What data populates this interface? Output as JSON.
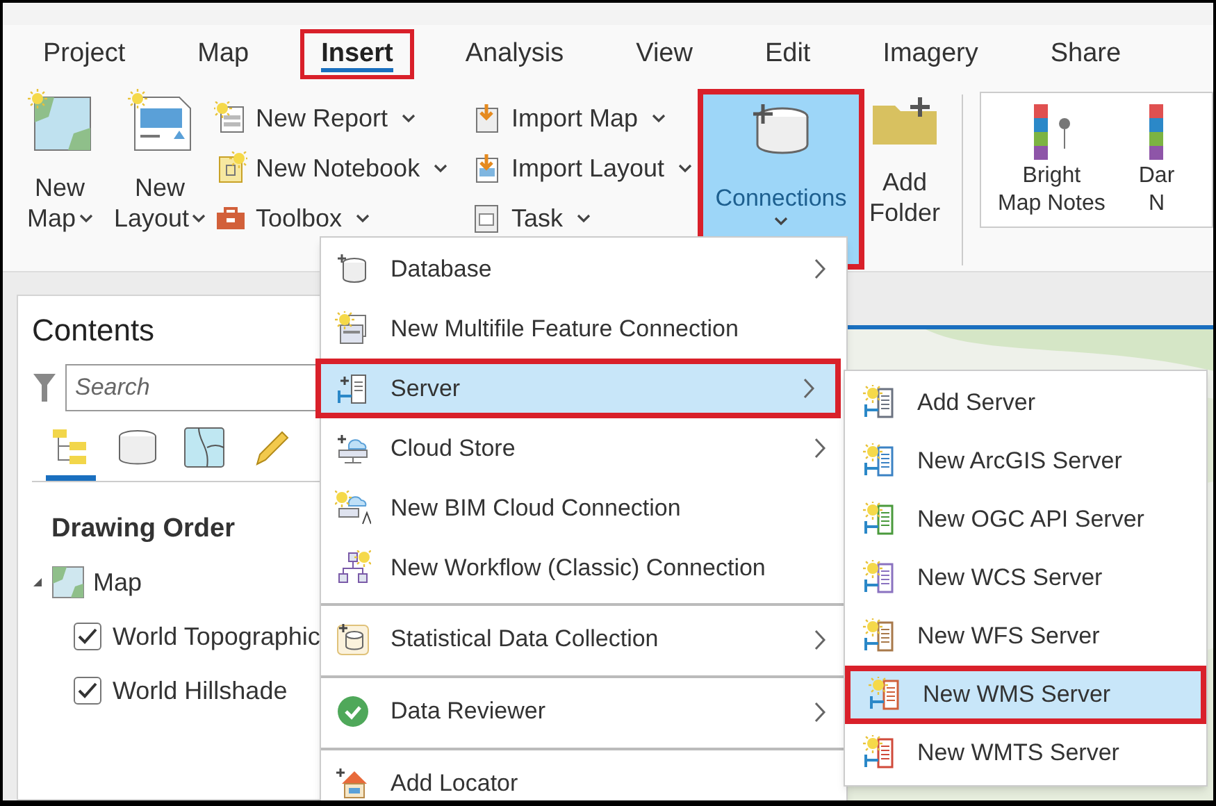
{
  "tabs": [
    {
      "label": "Project",
      "selected": false,
      "highlighted": false
    },
    {
      "label": "Map",
      "selected": false,
      "highlighted": false
    },
    {
      "label": "Insert",
      "selected": true,
      "highlighted": true
    },
    {
      "label": "Analysis",
      "selected": false,
      "highlighted": false
    },
    {
      "label": "View",
      "selected": false,
      "highlighted": false
    },
    {
      "label": "Edit",
      "selected": false,
      "highlighted": false
    },
    {
      "label": "Imagery",
      "selected": false,
      "highlighted": false
    },
    {
      "label": "Share",
      "selected": false,
      "highlighted": false
    }
  ],
  "ribbon": {
    "large_buttons": [
      {
        "kind": "map",
        "line1": "New",
        "line2": "Map"
      },
      {
        "kind": "layout",
        "line1": "New",
        "line2": "Layout"
      }
    ],
    "small_columns": [
      [
        {
          "kind": "report",
          "label": "New Report"
        },
        {
          "kind": "notebook",
          "label": "New Notebook"
        },
        {
          "kind": "toolbox",
          "label": "Toolbox"
        }
      ],
      [
        {
          "kind": "import-map",
          "label": "Import Map"
        },
        {
          "kind": "import-layout",
          "label": "Import Layout"
        },
        {
          "kind": "task",
          "label": "Task"
        }
      ]
    ],
    "connections": {
      "label": "Connections",
      "pressed": true,
      "highlighted": true
    },
    "add_folder": {
      "line1": "Add",
      "line2": "Folder"
    },
    "gallery": [
      {
        "line1": "Bright",
        "line2": "Map Notes"
      },
      {
        "line1": "Dar",
        "line2": "N"
      }
    ]
  },
  "contents": {
    "title": "Contents",
    "search": {
      "placeholder": "Search"
    },
    "views": [
      {
        "kind": "tree",
        "selected": true
      },
      {
        "kind": "database",
        "selected": false
      },
      {
        "kind": "map",
        "selected": false
      },
      {
        "kind": "pencil",
        "selected": false
      }
    ],
    "heading": "Drawing Order",
    "tree": [
      {
        "label": "Map",
        "expanded": true,
        "children": [
          {
            "label": "World Topographic",
            "checked": true
          },
          {
            "label": "World Hillshade",
            "checked": true
          }
        ]
      }
    ]
  },
  "menu": [
    {
      "kind": "database",
      "label": "Database",
      "submenu": true,
      "selected": false,
      "highlighted": false,
      "separator_before": false
    },
    {
      "kind": "multifile",
      "label": "New Multifile Feature Connection",
      "submenu": false,
      "selected": false,
      "highlighted": false,
      "separator_before": false
    },
    {
      "kind": "server",
      "label": "Server",
      "submenu": true,
      "selected": true,
      "highlighted": true,
      "separator_before": false
    },
    {
      "kind": "cloud",
      "label": "Cloud Store",
      "submenu": true,
      "selected": false,
      "highlighted": false,
      "separator_before": false
    },
    {
      "kind": "bim",
      "label": "New BIM Cloud Connection",
      "submenu": false,
      "selected": false,
      "highlighted": false,
      "separator_before": false
    },
    {
      "kind": "workflow",
      "label": "New Workflow (Classic) Connection",
      "submenu": false,
      "selected": false,
      "highlighted": false,
      "separator_before": false
    },
    {
      "kind": "statistical",
      "label": "Statistical Data Collection",
      "submenu": true,
      "selected": false,
      "highlighted": false,
      "separator_before": true
    },
    {
      "kind": "reviewer",
      "label": "Data Reviewer",
      "submenu": true,
      "selected": false,
      "highlighted": false,
      "separator_before": true
    },
    {
      "kind": "locator",
      "label": "Add Locator",
      "submenu": false,
      "selected": false,
      "highlighted": false,
      "separator_before": true
    }
  ],
  "submenu": [
    {
      "label": "Add Server",
      "color": "#6b7280",
      "selected": false,
      "highlighted": false
    },
    {
      "label": "New ArcGIS Server",
      "color": "#3b82c4",
      "selected": false,
      "highlighted": false
    },
    {
      "label": "New OGC API Server",
      "color": "#4a9a3c",
      "selected": false,
      "highlighted": false
    },
    {
      "label": "New WCS Server",
      "color": "#8a72c0",
      "selected": false,
      "highlighted": false
    },
    {
      "label": "New WFS Server",
      "color": "#a8794a",
      "selected": false,
      "highlighted": false
    },
    {
      "label": "New WMS Server",
      "color": "#d0603a",
      "selected": true,
      "highlighted": true
    },
    {
      "label": "New WMTS Server",
      "color": "#d04a3a",
      "selected": false,
      "highlighted": false
    }
  ]
}
